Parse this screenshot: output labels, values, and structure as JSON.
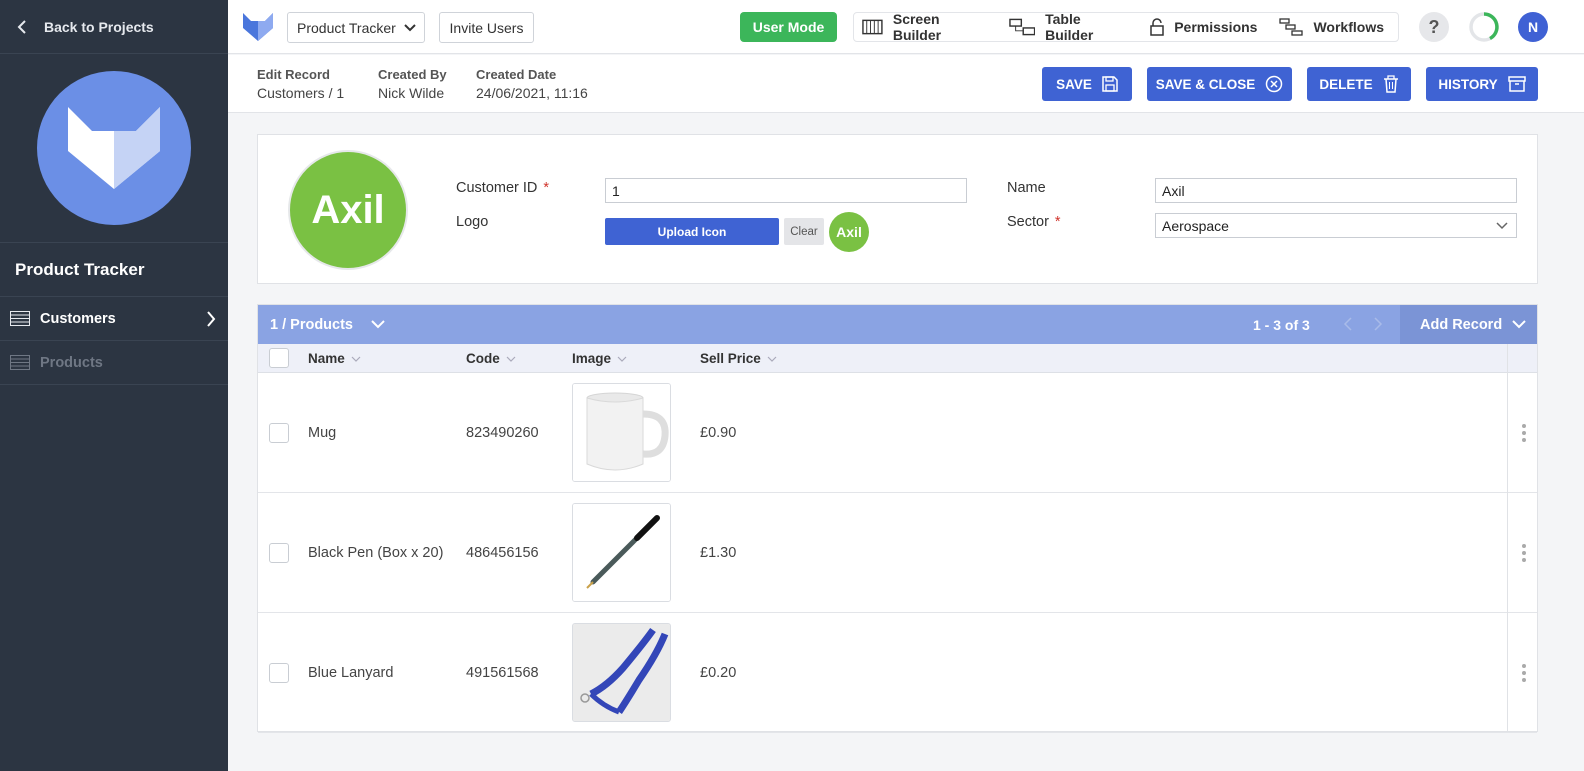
{
  "sidebar": {
    "back_label": "Back to Projects",
    "project_name": "Product Tracker",
    "items": [
      {
        "label": "Customers",
        "active": true
      },
      {
        "label": "Products",
        "active": false
      }
    ]
  },
  "topbar": {
    "project_select": "Product Tracker",
    "invite_label": "Invite Users",
    "user_mode_label": "User Mode",
    "builders": [
      "Screen Builder",
      "Table Builder",
      "Permissions",
      "Workflows"
    ],
    "help_label": "?",
    "avatar_initial": "N"
  },
  "record": {
    "edit_label": "Edit Record",
    "edit_value": "Customers / 1",
    "created_by_label": "Created By",
    "created_by_value": "Nick Wilde",
    "created_date_label": "Created Date",
    "created_date_value": "24/06/2021, 11:16",
    "actions": {
      "save": "SAVE",
      "save_close": "SAVE & CLOSE",
      "delete": "DELETE",
      "history": "HISTORY"
    }
  },
  "form": {
    "logo_text": "Axil",
    "customer_id_label": "Customer ID",
    "customer_id_value": "1",
    "logo_label": "Logo",
    "upload_label": "Upload Icon",
    "clear_label": "Clear",
    "name_label": "Name",
    "name_value": "Axil",
    "sector_label": "Sector",
    "sector_value": "Aerospace",
    "required_mark": "*"
  },
  "products": {
    "title": "1 / Products",
    "pager": "1 - 3 of 3",
    "add_record": "Add Record",
    "columns": [
      "Name",
      "Code",
      "Image",
      "Sell Price"
    ],
    "rows": [
      {
        "name": "Mug",
        "code": "823490260",
        "image": "mug-image",
        "price": "£0.90"
      },
      {
        "name": "Black Pen (Box x 20)",
        "code": "486456156",
        "image": "pen-image",
        "price": "£1.30"
      },
      {
        "name": "Blue Lanyard",
        "code": "491561568",
        "image": "lanyard-image",
        "price": "£0.20"
      }
    ]
  },
  "colors": {
    "sidebar_bg": "#2c3542",
    "accent_blue": "#3f63d3",
    "user_mode_green": "#3cb65a",
    "table_header": "#8aa3e3",
    "logo_green": "#7ac143"
  }
}
